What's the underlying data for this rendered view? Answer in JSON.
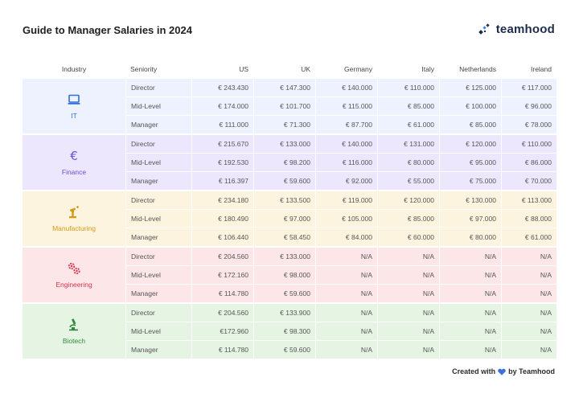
{
  "title": "Guide to Manager Salaries in 2024",
  "brand": {
    "name": "teamhood",
    "icon": "teamhood-logo-icon",
    "color": "#1d2b4c",
    "accent": "#3b82f6"
  },
  "columns": {
    "industry": "Industry",
    "seniority": "Seniority",
    "countries": [
      "US",
      "UK",
      "Germany",
      "Italy",
      "Netherlands",
      "Ireland"
    ]
  },
  "groups": [
    {
      "industry": "IT",
      "icon": "laptop-icon",
      "color": "#2f6fd6",
      "bg": "#eef1fe",
      "rows": [
        {
          "seniority": "Director",
          "values": [
            "€ 243.430",
            "€ 147.300",
            "€ 140.000",
            "€ 110.000",
            "€ 125.000",
            "€ 117.000"
          ]
        },
        {
          "seniority": "Mid-Level",
          "values": [
            "€ 174.000",
            "€ 101.700",
            "€ 115.000",
            "€ 85.000",
            "€ 100.000",
            "€ 96.000"
          ]
        },
        {
          "seniority": "Manager",
          "values": [
            "€ 111.000",
            "€ 71.300",
            "€ 87.700",
            "€ 61.000",
            "€ 85.000",
            "€ 78.000"
          ]
        }
      ]
    },
    {
      "industry": "Finance",
      "icon": "euro-icon",
      "color": "#6d4bd8",
      "bg": "#ece7fc",
      "rows": [
        {
          "seniority": "Director",
          "values": [
            "€ 215.670",
            "€ 133.000",
            "€ 140.000",
            "€ 131.000",
            "€ 120.000",
            "€ 110.000"
          ]
        },
        {
          "seniority": "Mid-Level",
          "values": [
            "€ 192.530",
            "€ 98.200",
            "€ 116.000",
            "€ 80.000",
            "€ 95.000",
            "€ 86.000"
          ]
        },
        {
          "seniority": "Manager",
          "values": [
            "€ 116.397",
            "€ 59.600",
            "€ 92.000",
            "€ 55.000",
            "€ 75.000",
            "€ 70.000"
          ]
        }
      ]
    },
    {
      "industry": "Manufacturing",
      "icon": "robot-arm-icon",
      "color": "#d69a12",
      "bg": "#fdf4df",
      "rows": [
        {
          "seniority": "Director",
          "values": [
            "€ 234.180",
            "€ 133.500",
            "€ 119.000",
            "€ 120.000",
            "€ 130.000",
            "€ 113.000"
          ]
        },
        {
          "seniority": "Mid-Level",
          "values": [
            "€ 180.490",
            "€ 97.000",
            "€ 105.000",
            "€ 85.000",
            "€ 97.000",
            "€ 88.000"
          ]
        },
        {
          "seniority": "Manager",
          "values": [
            "€ 106.440",
            "€ 58.450",
            "€ 84.000",
            "€ 60.000",
            "€ 80.000",
            "€ 61.000"
          ]
        }
      ]
    },
    {
      "industry": "Engineering",
      "icon": "gears-icon",
      "color": "#d6334a",
      "bg": "#fde6e8",
      "rows": [
        {
          "seniority": "Director",
          "values": [
            "€ 204.560",
            "€ 133.000",
            "N/A",
            "N/A",
            "N/A",
            "N/A"
          ]
        },
        {
          "seniority": "Mid-Level",
          "values": [
            "€ 172.160",
            "€ 98.000",
            "N/A",
            "N/A",
            "N/A",
            "N/A"
          ]
        },
        {
          "seniority": "Manager",
          "values": [
            "€ 114.780",
            "€ 59.600",
            "N/A",
            "N/A",
            "N/A",
            "N/A"
          ]
        }
      ]
    },
    {
      "industry": "Biotech",
      "icon": "microscope-icon",
      "color": "#2e8b3e",
      "bg": "#e6f4e4",
      "rows": [
        {
          "seniority": "Director",
          "values": [
            "€ 204.560",
            "€ 133.900",
            "N/A",
            "N/A",
            "N/A",
            "N/A"
          ]
        },
        {
          "seniority": "Mid-Level",
          "values": [
            "€172.960",
            "€ 98.300",
            "N/A",
            "N/A",
            "N/A",
            "N/A"
          ]
        },
        {
          "seniority": "Manager",
          "values": [
            "€ 114.780",
            "€ 59.600",
            "N/A",
            "N/A",
            "N/A",
            "N/A"
          ]
        }
      ]
    }
  ],
  "footer": {
    "prefix": "Created with",
    "suffix": "by Teamhood",
    "icon": "heart-icon",
    "icon_color": "#3b6fe0"
  }
}
